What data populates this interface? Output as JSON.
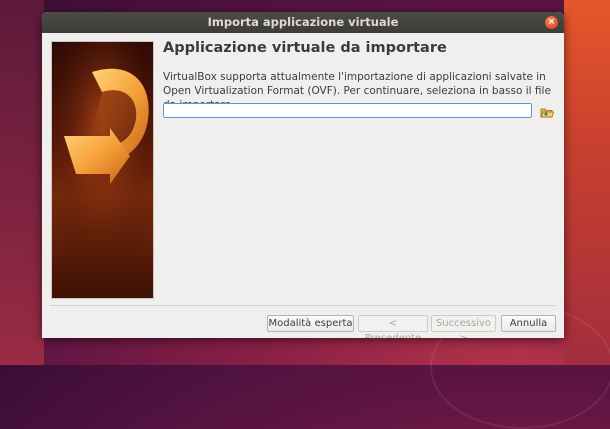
{
  "window": {
    "title": "Importa applicazione virtuale"
  },
  "page": {
    "heading": "Applicazione virtuale da importare",
    "description": "VirtualBox supporta attualmente l'importazione di applicazioni salvate in Open Virtualization Format (OVF). Per continuare, seleziona in basso il file da importare.",
    "file_path_value": ""
  },
  "buttons": {
    "expert": "Modalità esperta",
    "previous": "< Precedente",
    "next": "Successivo >",
    "cancel": "Annulla"
  },
  "icons": {
    "close": "close-icon",
    "folder": "open-folder-icon",
    "banner": "import-arrow-banner"
  },
  "colors": {
    "accent": "#e2572d",
    "input_focus": "#5b97d6"
  }
}
